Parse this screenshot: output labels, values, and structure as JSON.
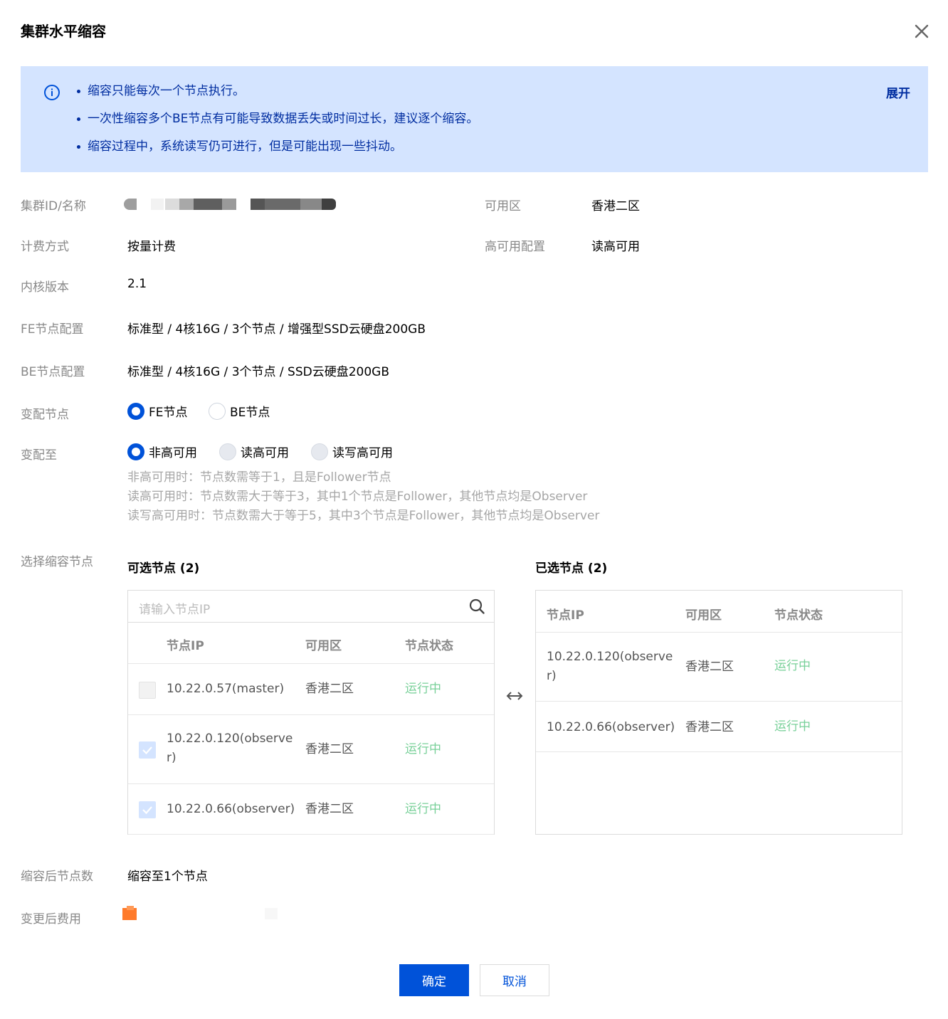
{
  "dialog": {
    "title": "集群水平缩容"
  },
  "notice": {
    "items": [
      "缩容只能每次一个节点执行。",
      "一次性缩容多个BE节点有可能导致数据丢失或时间过长，建议逐个缩容。",
      "缩容过程中，系统读写仍可进行，但是可能出现一些抖动。"
    ],
    "expand_label": "展开"
  },
  "info": {
    "cluster_label": "集群ID/名称",
    "zone_label": "可用区",
    "zone_value": "香港二区",
    "billing_label": "计费方式",
    "billing_value": "按量计费",
    "ha_label": "高可用配置",
    "ha_value": "读高可用",
    "kernel_label": "内核版本",
    "kernel_value": "2.1",
    "fe_label": "FE节点配置",
    "fe_value": "标准型 / 4核16G / 3个节点 / 增强型SSD云硬盘200GB",
    "be_label": "BE节点配置",
    "be_value": "标准型 / 4核16G / 3个节点 / SSD云硬盘200GB"
  },
  "node_type": {
    "label": "变配节点",
    "options": [
      "FE节点",
      "BE节点"
    ],
    "selected": "FE节点"
  },
  "target": {
    "label": "变配至",
    "options": [
      "非高可用",
      "读高可用",
      "读写高可用"
    ],
    "selected": "非高可用",
    "hints": [
      "非高可用时：节点数需等于1，且是Follower节点",
      "读高可用时：节点数需大于等于3，其中1个节点是Follower，其他节点均是Observer",
      "读写高可用时：节点数需大于等于5，其中3个节点是Follower，其他节点均是Observer"
    ]
  },
  "transfer": {
    "label": "选择缩容节点",
    "left_title": "可选节点 (2)",
    "right_title": "已选节点 (2)",
    "search_placeholder": "请输入节点IP",
    "columns": [
      "节点IP",
      "可用区",
      "节点状态"
    ],
    "left_rows": [
      {
        "ip": "10.22.0.57(master)",
        "zone": "香港二区",
        "status": "运行中",
        "checkbox": "disabled"
      },
      {
        "ip": "10.22.0.120(observe r)",
        "zone": "香港二区",
        "status": "运行中",
        "checkbox": "checked"
      },
      {
        "ip": "10.22.0.66(observer)",
        "zone": "香港二区",
        "status": "运行中",
        "checkbox": "checked"
      }
    ],
    "right_rows": [
      {
        "ip": "10.22.0.120(observe r)",
        "zone": "香港二区",
        "status": "运行中"
      },
      {
        "ip": "10.22.0.66(observer)",
        "zone": "香港二区",
        "status": "运行中"
      }
    ]
  },
  "result": {
    "count_label": "缩容后节点数",
    "count_value": "缩容至1个节点",
    "fee_label": "变更后费用"
  },
  "footer": {
    "confirm_label": "确定",
    "cancel_label": "取消"
  },
  "colors": {
    "primary": "#0052d9",
    "notice_bg": "#d4e4ff",
    "notice_text": "#002da0",
    "status_running": "#78d099",
    "price": "#ff7200"
  }
}
